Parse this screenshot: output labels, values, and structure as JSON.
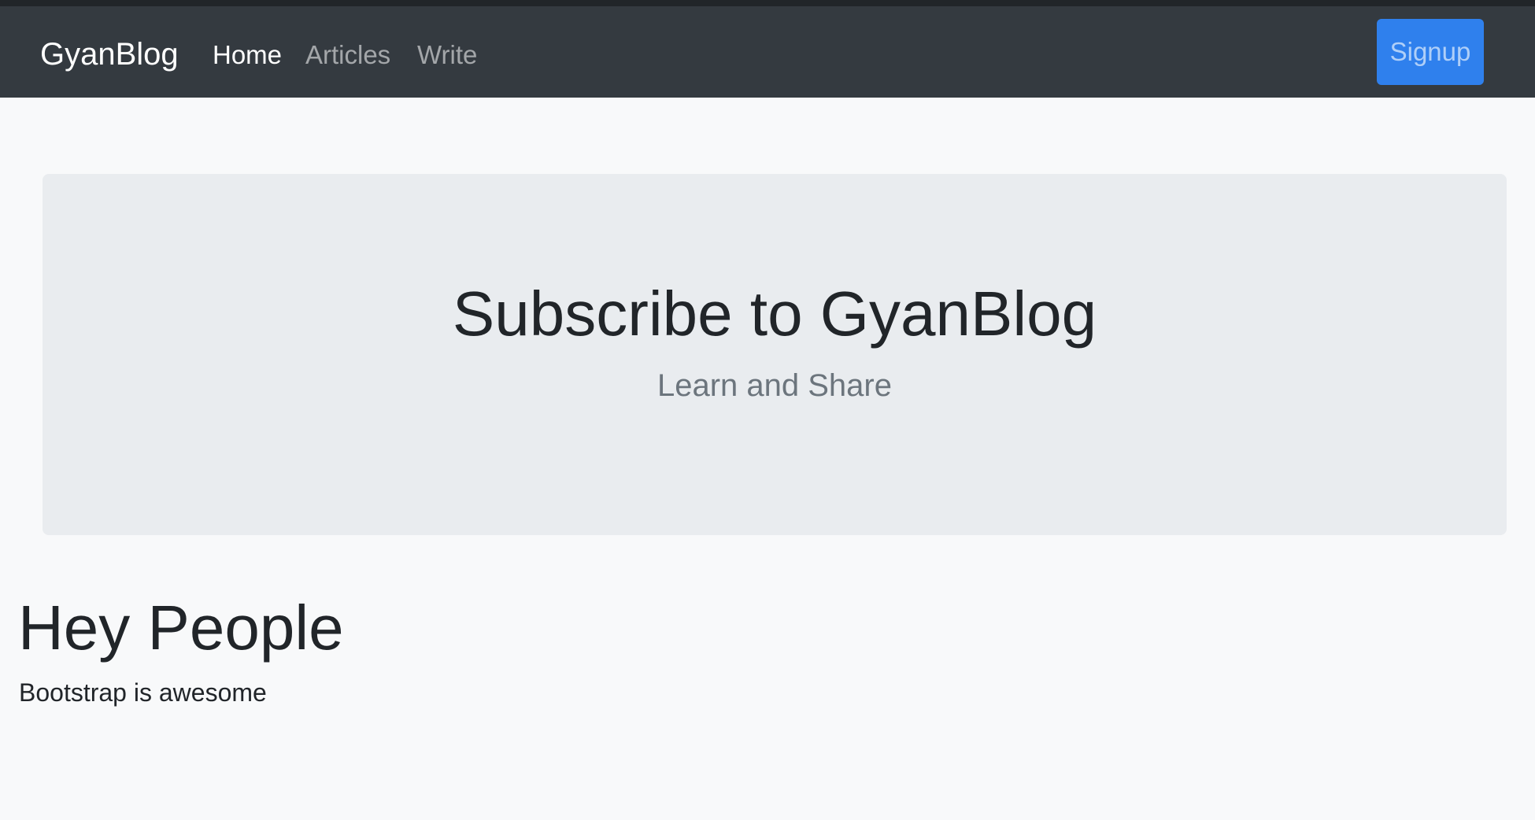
{
  "navbar": {
    "brand": "GyanBlog",
    "links": [
      {
        "label": "Home",
        "active": true
      },
      {
        "label": "Articles",
        "active": false
      },
      {
        "label": "Write",
        "active": false
      }
    ],
    "signup_label": "Signup"
  },
  "jumbotron": {
    "title": "Subscribe to GyanBlog",
    "subtitle": "Learn and Share"
  },
  "content": {
    "heading": "Hey People",
    "text": "Bootstrap is awesome"
  },
  "colors": {
    "navbar_bg": "#343a40",
    "primary_button": "#2f80ed",
    "jumbotron_bg": "#e9ecef",
    "page_bg": "#f8f9fa",
    "muted_text": "#6c757d"
  }
}
